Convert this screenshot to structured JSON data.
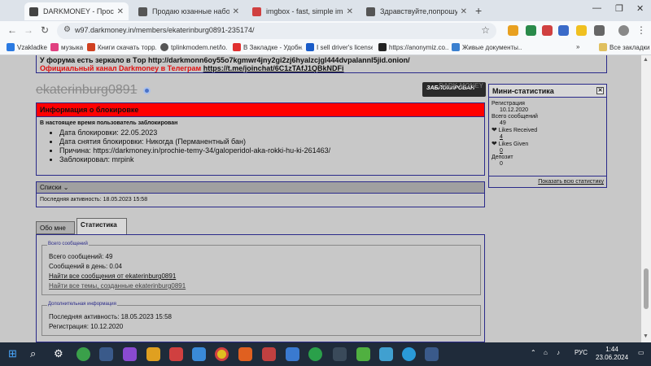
{
  "browser": {
    "tabs": [
      {
        "title": "DARKMONEY - Просмотр проф",
        "color": "#444444",
        "active": true
      },
      {
        "title": "Продаю юзанные наборы ре",
        "color": "#555555"
      },
      {
        "title": "imgbox - fast, simple image ho",
        "color": "#d04040"
      },
      {
        "title": "Здравствуйте,попрошу забан",
        "color": "#555555"
      }
    ],
    "new_tab": "+",
    "window_controls": {
      "minimize": "—",
      "restore": "❐",
      "close": "✕"
    },
    "url": "w97.darkmoney.in/members/ekaterinburg0891-235174/",
    "nav": {
      "back": "←",
      "forward": "→",
      "reload": "↻"
    },
    "bookmarks": [
      {
        "label": "Vzakladke",
        "color": "#2a7ae2"
      },
      {
        "label": "музыка",
        "color": "#e04080"
      },
      {
        "label": "Книги скачать торр...",
        "color": "#d04020"
      },
      {
        "label": "tplinkmodem.net/lo...",
        "color": "#555555"
      },
      {
        "label": "В Закладке - Удобн...",
        "color": "#e03030"
      },
      {
        "label": "I sell driver's license...",
        "color": "#1a5cc8"
      },
      {
        "label": "https://anonymiz.co...",
        "color": "#222222"
      },
      {
        "label": "Живые документы...",
        "color": "#3a80d0"
      }
    ],
    "all_bookmarks": "Все закладки"
  },
  "forum": {
    "mirror_line": "У форума есть зеркало в Tор http://darkmonn6oy55o7kgmwr4jny2gi2zj6hyalzcjgl444dvpalannl5jid.onion/",
    "telegram_label": "Официальный канал Darkmoney в Телеграм",
    "telegram_link": "https://t.me/joinchat/6C1zTAfJ1QBkNDFi",
    "username": "ekaterinburg0891",
    "banned_stamp": "ЗАБЛОКИРОВАН",
    "banned_watermark": "DARK MONEY",
    "ban": {
      "header": "Информация о блокировке",
      "note": "В настоящее время пользователь заблокирован",
      "items": [
        "Дата блокировки: 22.05.2023",
        "Дата снятия блокировки: Никогда (Перманентный бан)",
        "Причина: https://darkmoney.in/prochie-temy-34/galoperidol-aka-rokki-hu-ki-261463/",
        "Заблокировал: mrpink"
      ]
    },
    "lists": {
      "header": "Списки",
      "last_activity": "Последняя активность: 18.05.2023 15:58"
    },
    "profile_tabs": [
      "Обо мне",
      "Статистика"
    ],
    "stats": {
      "total_legend": "Всего сообщений",
      "total_posts": "Всего сообщений: 49",
      "per_day": "Сообщений в день: 0.04",
      "find_posts": "Найти все сообщения от ekaterinburg0891",
      "find_threads": "Найти все темы, созданные ekaterinburg0891",
      "extra_legend": "Дополнительная информация",
      "last_activity": "Последняя активность: 18.05.2023 15:58",
      "registration": "Регистрация: 10.12.2020"
    },
    "mini_stats": {
      "header": "Мини-статистика",
      "registration_label": "Регистрация",
      "registration_value": "10.12.2020",
      "posts_label": "Всего сообщений",
      "posts_value": "49",
      "likes_received_label": "Likes Received",
      "likes_received_value": "4",
      "likes_given_label": "Likes Given",
      "likes_given_value": "0",
      "deposit_label": "Депозит",
      "deposit_value": "0",
      "show_all": "Показать всю статистику"
    }
  },
  "taskbar": {
    "lang": "РУС",
    "time": "1:44",
    "date": "23.06.2024"
  }
}
